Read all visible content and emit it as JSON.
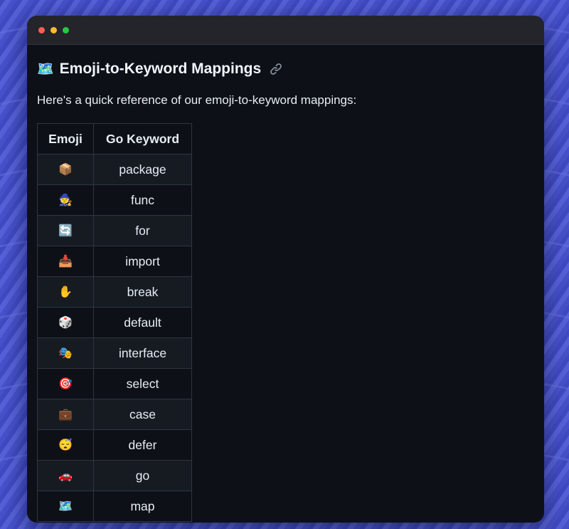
{
  "window": {
    "traffic_lights": [
      {
        "name": "close",
        "color": "#ff5f57"
      },
      {
        "name": "minimize",
        "color": "#febc2e"
      },
      {
        "name": "zoom",
        "color": "#28c840"
      }
    ]
  },
  "heading": {
    "emoji": "🗺️",
    "text": "Emoji-to-Keyword Mappings",
    "link_icon": "link-icon"
  },
  "intro": "Here's a quick reference of our emoji-to-keyword mappings:",
  "table": {
    "headers": [
      "Emoji",
      "Go Keyword"
    ],
    "rows": [
      {
        "emoji": "📦",
        "keyword": "package"
      },
      {
        "emoji": "🧙",
        "keyword": "func"
      },
      {
        "emoji": "🔄",
        "keyword": "for"
      },
      {
        "emoji": "📥",
        "keyword": "import"
      },
      {
        "emoji": "✋",
        "keyword": "break"
      },
      {
        "emoji": "🎲",
        "keyword": "default"
      },
      {
        "emoji": "🎭",
        "keyword": "interface"
      },
      {
        "emoji": "🎯",
        "keyword": "select"
      },
      {
        "emoji": "💼",
        "keyword": "case"
      },
      {
        "emoji": "😴",
        "keyword": "defer"
      },
      {
        "emoji": "🚗",
        "keyword": "go"
      },
      {
        "emoji": "🗺️",
        "keyword": "map"
      }
    ]
  },
  "colors": {
    "window_bg": "#0d1117",
    "titlebar_bg": "#24252a",
    "border": "#30363d",
    "text": "#e6edf3",
    "backdrop": "#4a52c8"
  }
}
